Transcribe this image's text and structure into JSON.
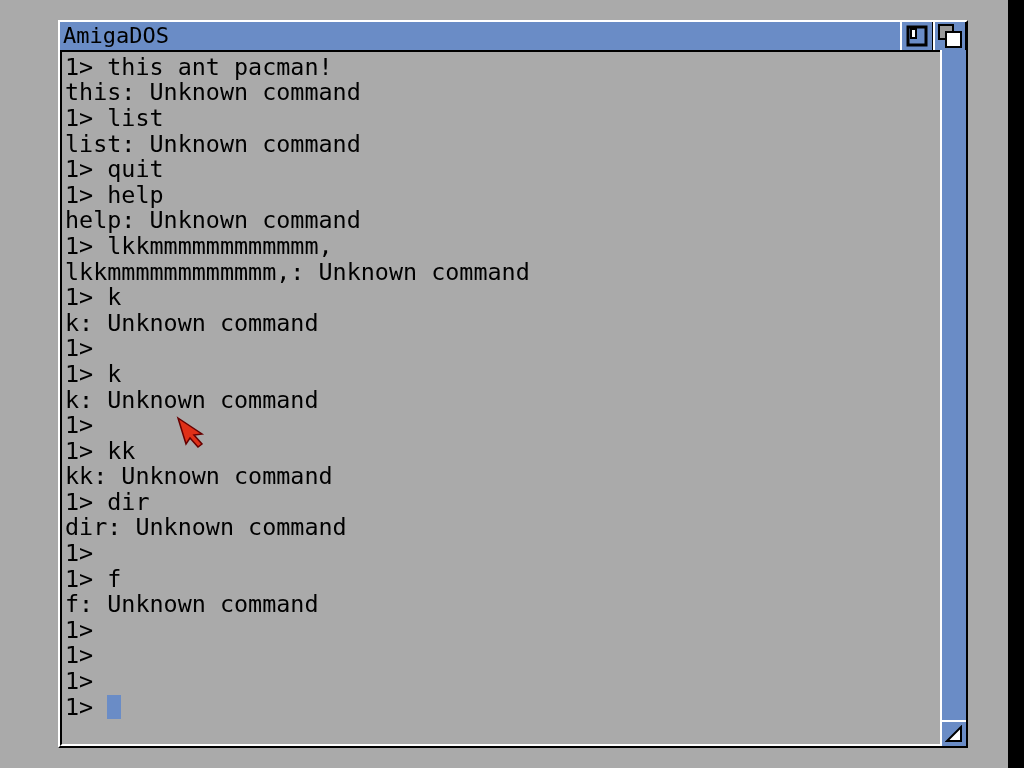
{
  "window": {
    "title": "AmigaDOS"
  },
  "lines": [
    "1> this ant pacman!",
    "this: Unknown command",
    "1> list",
    "list: Unknown command",
    "1> quit",
    "1> help",
    "help: Unknown command",
    "1> lkkmmmmmmmmmmmm,",
    "lkkmmmmmmmmmmmm,: Unknown command",
    "1> k",
    "k: Unknown command",
    "1>",
    "1> k",
    "k: Unknown command",
    "1>",
    "1> kk",
    "kk: Unknown command",
    "1> dir",
    "dir: Unknown command",
    "1>",
    "1> f",
    "f: Unknown command",
    "1>",
    "1>",
    "1>"
  ],
  "input_line": {
    "prompt": "1>"
  }
}
